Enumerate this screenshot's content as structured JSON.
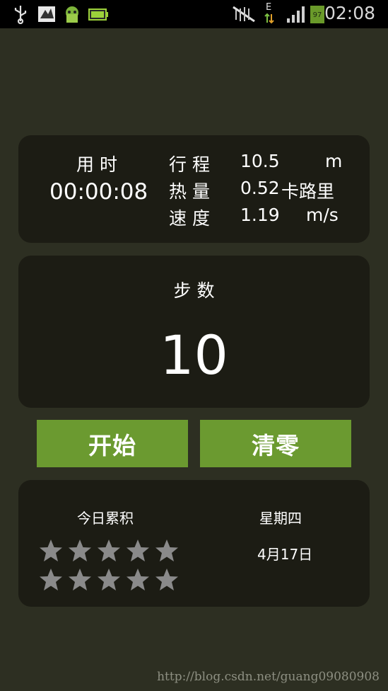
{
  "status_bar": {
    "time": "02:08",
    "battery_percent": "97",
    "network_type": "E",
    "icons": [
      "usb-icon",
      "app-icon",
      "android-icon",
      "battery-app-icon",
      "mute-icon",
      "data-arrows-icon",
      "signal-icon",
      "battery-icon"
    ]
  },
  "stats": {
    "elapsed_label": "用 时",
    "elapsed_value": "00:00:08",
    "distance_label": "行 程",
    "distance_value": "10.5",
    "distance_unit": "m",
    "calories_label": "热 量",
    "calories_value": "0.52",
    "calories_unit": "卡路里",
    "speed_label": "速 度",
    "speed_value": "1.19",
    "speed_unit": "m/s"
  },
  "steps": {
    "label": "步 数",
    "value": "10"
  },
  "buttons": {
    "start_label": "开始",
    "reset_label": "清零"
  },
  "today": {
    "label": "今日累积",
    "weekday": "星期四",
    "date": "4月17日",
    "stars_total": 10,
    "stars_filled": 0
  },
  "watermark": "http://blog.csdn.net/guang09080908",
  "colors": {
    "background": "#2d2f22",
    "card": "#1c1c14",
    "button": "#6b9a30",
    "star": "#8a8a8a"
  }
}
